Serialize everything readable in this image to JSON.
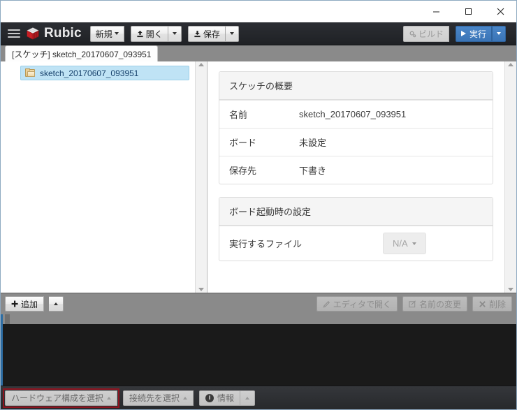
{
  "window": {
    "controls": {
      "minimize": "minimize-button",
      "maximize": "maximize-button",
      "close": "close-button"
    }
  },
  "toolbar": {
    "menu_label": "menu",
    "brand": "Rubic",
    "new_label": "新規",
    "open_label": "開く",
    "save_label": "保存",
    "build_label": "ビルド",
    "run_label": "実行"
  },
  "tab": {
    "label": "[スケッチ] sketch_20170607_093951"
  },
  "sidebar": {
    "tree": [
      {
        "label": "sketch_20170607_093951",
        "selected": true,
        "icon": "folder-icon"
      }
    ]
  },
  "main": {
    "panels": [
      {
        "title": "スケッチの概要",
        "rows": [
          {
            "key": "名前",
            "value": "sketch_20170607_093951"
          },
          {
            "key": "ボード",
            "value": "未設定"
          },
          {
            "key": "保存先",
            "value": "下書き"
          }
        ]
      },
      {
        "title": "ボード起動時の設定",
        "rows": [
          {
            "key": "実行するファイル",
            "value": "N/A"
          }
        ]
      }
    ]
  },
  "actionbar": {
    "add_label": "追加",
    "open_editor_label": "エディタで開く",
    "rename_label": "名前の変更",
    "delete_label": "削除"
  },
  "statusbar": {
    "hardware_label": "ハードウェア構成を選択",
    "connection_label": "接続先を選択",
    "info_label": "情報"
  },
  "colors": {
    "toolbar_bg": "#24262a",
    "accent_blue": "#3a74b6",
    "selection_blue": "#bfe3f5",
    "focus_red": "#8f1420",
    "console_bg": "#1a1a1a"
  }
}
